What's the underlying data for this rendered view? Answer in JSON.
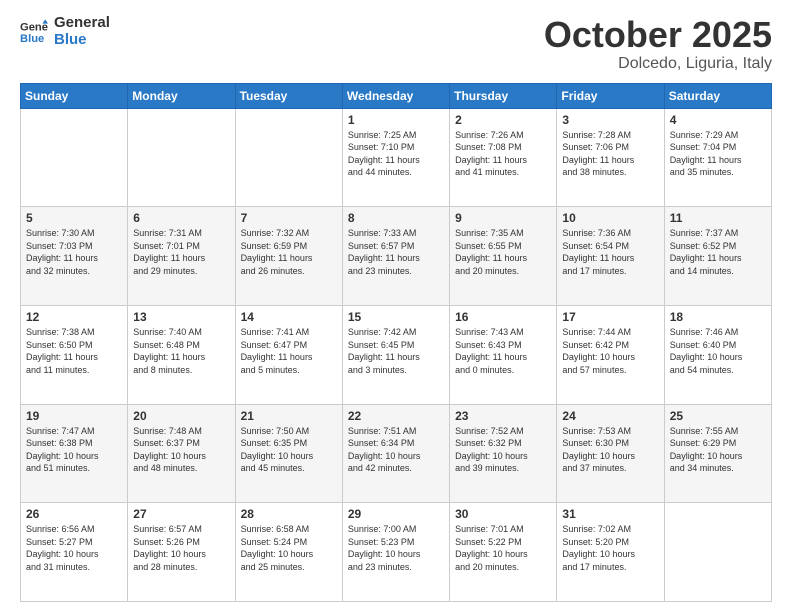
{
  "header": {
    "logo_line1": "General",
    "logo_line2": "Blue",
    "month": "October 2025",
    "location": "Dolcedo, Liguria, Italy"
  },
  "days_of_week": [
    "Sunday",
    "Monday",
    "Tuesday",
    "Wednesday",
    "Thursday",
    "Friday",
    "Saturday"
  ],
  "weeks": [
    [
      {
        "day": "",
        "content": ""
      },
      {
        "day": "",
        "content": ""
      },
      {
        "day": "",
        "content": ""
      },
      {
        "day": "1",
        "content": "Sunrise: 7:25 AM\nSunset: 7:10 PM\nDaylight: 11 hours\nand 44 minutes."
      },
      {
        "day": "2",
        "content": "Sunrise: 7:26 AM\nSunset: 7:08 PM\nDaylight: 11 hours\nand 41 minutes."
      },
      {
        "day": "3",
        "content": "Sunrise: 7:28 AM\nSunset: 7:06 PM\nDaylight: 11 hours\nand 38 minutes."
      },
      {
        "day": "4",
        "content": "Sunrise: 7:29 AM\nSunset: 7:04 PM\nDaylight: 11 hours\nand 35 minutes."
      }
    ],
    [
      {
        "day": "5",
        "content": "Sunrise: 7:30 AM\nSunset: 7:03 PM\nDaylight: 11 hours\nand 32 minutes."
      },
      {
        "day": "6",
        "content": "Sunrise: 7:31 AM\nSunset: 7:01 PM\nDaylight: 11 hours\nand 29 minutes."
      },
      {
        "day": "7",
        "content": "Sunrise: 7:32 AM\nSunset: 6:59 PM\nDaylight: 11 hours\nand 26 minutes."
      },
      {
        "day": "8",
        "content": "Sunrise: 7:33 AM\nSunset: 6:57 PM\nDaylight: 11 hours\nand 23 minutes."
      },
      {
        "day": "9",
        "content": "Sunrise: 7:35 AM\nSunset: 6:55 PM\nDaylight: 11 hours\nand 20 minutes."
      },
      {
        "day": "10",
        "content": "Sunrise: 7:36 AM\nSunset: 6:54 PM\nDaylight: 11 hours\nand 17 minutes."
      },
      {
        "day": "11",
        "content": "Sunrise: 7:37 AM\nSunset: 6:52 PM\nDaylight: 11 hours\nand 14 minutes."
      }
    ],
    [
      {
        "day": "12",
        "content": "Sunrise: 7:38 AM\nSunset: 6:50 PM\nDaylight: 11 hours\nand 11 minutes."
      },
      {
        "day": "13",
        "content": "Sunrise: 7:40 AM\nSunset: 6:48 PM\nDaylight: 11 hours\nand 8 minutes."
      },
      {
        "day": "14",
        "content": "Sunrise: 7:41 AM\nSunset: 6:47 PM\nDaylight: 11 hours\nand 5 minutes."
      },
      {
        "day": "15",
        "content": "Sunrise: 7:42 AM\nSunset: 6:45 PM\nDaylight: 11 hours\nand 3 minutes."
      },
      {
        "day": "16",
        "content": "Sunrise: 7:43 AM\nSunset: 6:43 PM\nDaylight: 11 hours\nand 0 minutes."
      },
      {
        "day": "17",
        "content": "Sunrise: 7:44 AM\nSunset: 6:42 PM\nDaylight: 10 hours\nand 57 minutes."
      },
      {
        "day": "18",
        "content": "Sunrise: 7:46 AM\nSunset: 6:40 PM\nDaylight: 10 hours\nand 54 minutes."
      }
    ],
    [
      {
        "day": "19",
        "content": "Sunrise: 7:47 AM\nSunset: 6:38 PM\nDaylight: 10 hours\nand 51 minutes."
      },
      {
        "day": "20",
        "content": "Sunrise: 7:48 AM\nSunset: 6:37 PM\nDaylight: 10 hours\nand 48 minutes."
      },
      {
        "day": "21",
        "content": "Sunrise: 7:50 AM\nSunset: 6:35 PM\nDaylight: 10 hours\nand 45 minutes."
      },
      {
        "day": "22",
        "content": "Sunrise: 7:51 AM\nSunset: 6:34 PM\nDaylight: 10 hours\nand 42 minutes."
      },
      {
        "day": "23",
        "content": "Sunrise: 7:52 AM\nSunset: 6:32 PM\nDaylight: 10 hours\nand 39 minutes."
      },
      {
        "day": "24",
        "content": "Sunrise: 7:53 AM\nSunset: 6:30 PM\nDaylight: 10 hours\nand 37 minutes."
      },
      {
        "day": "25",
        "content": "Sunrise: 7:55 AM\nSunset: 6:29 PM\nDaylight: 10 hours\nand 34 minutes."
      }
    ],
    [
      {
        "day": "26",
        "content": "Sunrise: 6:56 AM\nSunset: 5:27 PM\nDaylight: 10 hours\nand 31 minutes."
      },
      {
        "day": "27",
        "content": "Sunrise: 6:57 AM\nSunset: 5:26 PM\nDaylight: 10 hours\nand 28 minutes."
      },
      {
        "day": "28",
        "content": "Sunrise: 6:58 AM\nSunset: 5:24 PM\nDaylight: 10 hours\nand 25 minutes."
      },
      {
        "day": "29",
        "content": "Sunrise: 7:00 AM\nSunset: 5:23 PM\nDaylight: 10 hours\nand 23 minutes."
      },
      {
        "day": "30",
        "content": "Sunrise: 7:01 AM\nSunset: 5:22 PM\nDaylight: 10 hours\nand 20 minutes."
      },
      {
        "day": "31",
        "content": "Sunrise: 7:02 AM\nSunset: 5:20 PM\nDaylight: 10 hours\nand 17 minutes."
      },
      {
        "day": "",
        "content": ""
      }
    ]
  ]
}
